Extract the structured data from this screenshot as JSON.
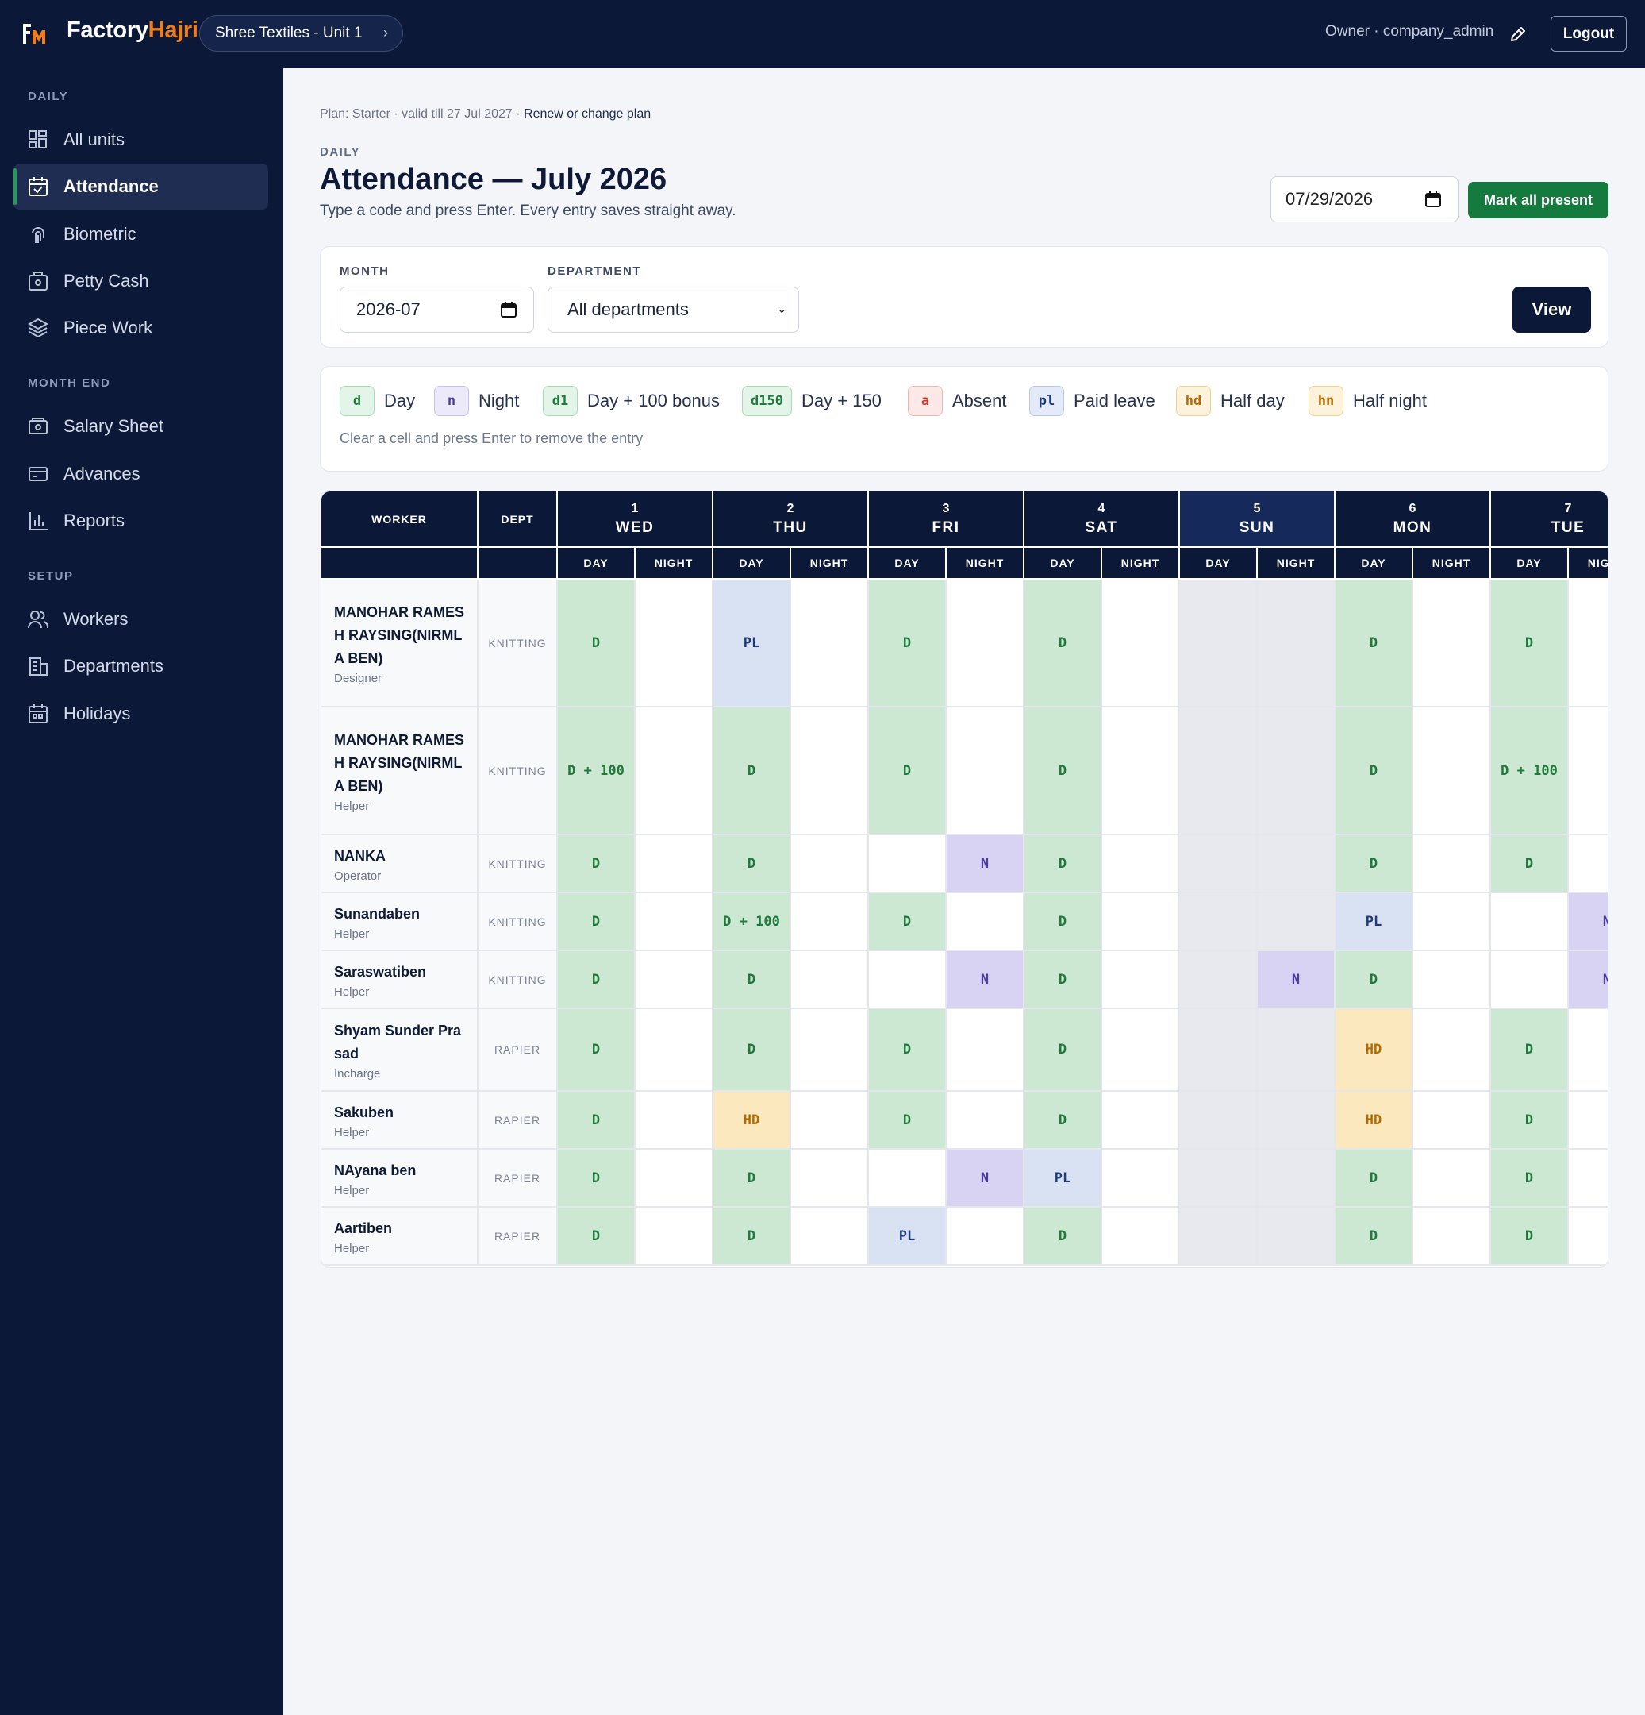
{
  "topbar": {
    "brand_a": "Factory",
    "brand_b": "Hajri",
    "unit": "Shree Textiles - Unit 1",
    "owner": "Owner · company_admin",
    "logout": "Logout"
  },
  "sidebar": {
    "sections": [
      "DAILY",
      "MONTH END",
      "SETUP"
    ],
    "items": [
      {
        "label": "All units",
        "icon": "grid-icon"
      },
      {
        "label": "Attendance",
        "icon": "calendar-check-icon"
      },
      {
        "label": "Biometric",
        "icon": "fingerprint-icon"
      },
      {
        "label": "Petty Cash",
        "icon": "cash-box-icon"
      },
      {
        "label": "Piece Work",
        "icon": "layers-icon"
      },
      {
        "label": "Salary Sheet",
        "icon": "money-icon"
      },
      {
        "label": "Advances",
        "icon": "card-icon"
      },
      {
        "label": "Reports",
        "icon": "bar-chart-icon"
      },
      {
        "label": "Workers",
        "icon": "users-icon"
      },
      {
        "label": "Departments",
        "icon": "building-icon"
      },
      {
        "label": "Holidays",
        "icon": "calendar-icon"
      }
    ]
  },
  "main": {
    "plan_text": "Plan: Starter · valid till 27 Jul 2027 · ",
    "plan_link": "Renew or change plan",
    "section": "DAILY",
    "title": "Attendance — July 2026",
    "subtitle": "Type a code and press Enter. Every entry saves straight away.",
    "date_value": "07/29/2026",
    "mark_all": "Mark all present"
  },
  "filters": {
    "month_label": "MONTH",
    "month_value": "2026-07",
    "dept_label": "DEPARTMENT",
    "dept_value": "All departments",
    "view": "View"
  },
  "legend": {
    "items": [
      {
        "code": "d",
        "text": "Day"
      },
      {
        "code": "n",
        "text": "Night"
      },
      {
        "code": "d1",
        "text": "Day + 100 bonus"
      },
      {
        "code": "d150",
        "text": "Day + 150"
      },
      {
        "code": "a",
        "text": "Absent"
      },
      {
        "code": "pl",
        "text": "Paid leave"
      },
      {
        "code": "hd",
        "text": "Half day"
      },
      {
        "code": "hn",
        "text": "Half night"
      }
    ],
    "hint": "Clear a cell and press Enter to remove the entry"
  },
  "grid": {
    "worker_header": "WORKER",
    "dept_header": "DEPT",
    "shift_labels": [
      "DAY",
      "NIGHT"
    ],
    "days": [
      {
        "num": "1",
        "dow": "WED"
      },
      {
        "num": "2",
        "dow": "THU"
      },
      {
        "num": "3",
        "dow": "FRI"
      },
      {
        "num": "4",
        "dow": "SAT"
      },
      {
        "num": "5",
        "dow": "SUN"
      },
      {
        "num": "6",
        "dow": "MON"
      },
      {
        "num": "7",
        "dow": "TUE"
      }
    ],
    "rows": [
      {
        "name": "MANOHAR RAMESH RAYSING(NIRMLA BEN)",
        "role": "Designer",
        "dept": "KNITTING",
        "cells": [
          "D",
          "",
          "PL",
          "",
          "D",
          "",
          "D",
          "",
          "",
          "",
          "D",
          "",
          "D",
          ""
        ]
      },
      {
        "name": "MANOHAR RAMESH RAYSING(NIRMLA BEN)",
        "role": "Helper",
        "dept": "KNITTING",
        "cells": [
          "D + 100",
          "",
          "D",
          "",
          "D",
          "",
          "D",
          "",
          "",
          "",
          "D",
          "",
          "D + 100",
          ""
        ]
      },
      {
        "name": "NANKA",
        "role": "Operator",
        "dept": "KNITTING",
        "cells": [
          "D",
          "",
          "D",
          "",
          "",
          "N",
          "D",
          "",
          "",
          "",
          "D",
          "",
          "D",
          ""
        ]
      },
      {
        "name": "Sunandaben",
        "role": "Helper",
        "dept": "KNITTING",
        "cells": [
          "D",
          "",
          "D + 100",
          "",
          "D",
          "",
          "D",
          "",
          "",
          "",
          "PL",
          "",
          "",
          "N"
        ]
      },
      {
        "name": "Saraswatiben",
        "role": "Helper",
        "dept": "KNITTING",
        "cells": [
          "D",
          "",
          "D",
          "",
          "",
          "N",
          "D",
          "",
          "",
          "N",
          "D",
          "",
          "",
          "N"
        ]
      },
      {
        "name": "Shyam Sunder Prasad",
        "role": "Incharge",
        "dept": "RAPIER",
        "cells": [
          "D",
          "",
          "D",
          "",
          "D",
          "",
          "D",
          "",
          "",
          "",
          "HD",
          "",
          "D",
          ""
        ]
      },
      {
        "name": "Sakuben",
        "role": "Helper",
        "dept": "RAPIER",
        "cells": [
          "D",
          "",
          "HD",
          "",
          "D",
          "",
          "D",
          "",
          "",
          "",
          "HD",
          "",
          "D",
          ""
        ]
      },
      {
        "name": "NAyana ben",
        "role": "Helper",
        "dept": "RAPIER",
        "cells": [
          "D",
          "",
          "D",
          "",
          "",
          "N",
          "PL",
          "",
          "",
          "",
          "D",
          "",
          "D",
          ""
        ]
      },
      {
        "name": "Aartiben",
        "role": "Helper",
        "dept": "RAPIER",
        "cells": [
          "D",
          "",
          "D",
          "",
          "PL",
          "",
          "D",
          "",
          "",
          "",
          "D",
          "",
          "D",
          ""
        ]
      }
    ]
  },
  "colors": {
    "navy": "#0b1838",
    "accent_green": "#157a3d",
    "brand_orange": "#f07c1c",
    "day_bg": "#cce8d3",
    "day_fg": "#1f7a3c",
    "night_bg": "#d9d3f3",
    "night_fg": "#4a3aa8",
    "pl_bg": "#d9e2f3",
    "pl_fg": "#1d3a7a",
    "hd_bg": "#fbe8bf",
    "hd_fg": "#b36b00",
    "sunday_bg": "#e7e9ee"
  }
}
